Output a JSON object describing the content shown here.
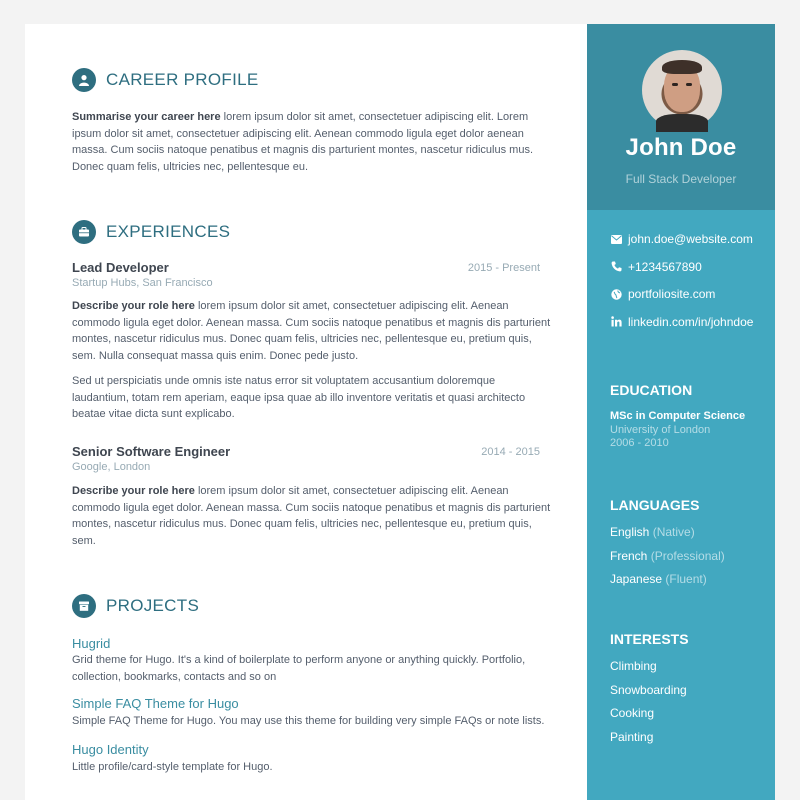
{
  "profile": {
    "name": "John Doe",
    "tagline": "Full Stack Developer"
  },
  "contact": [
    {
      "icon": "email-icon",
      "text": "john.doe@website.com"
    },
    {
      "icon": "phone-icon",
      "text": "+1234567890"
    },
    {
      "icon": "globe-icon",
      "text": "portfoliosite.com"
    },
    {
      "icon": "linkedin-icon",
      "text": "linkedin.com/in/johndoe"
    }
  ],
  "education": {
    "title": "EDUCATION",
    "degree": "MSc in Computer Science",
    "school": "University of London",
    "years": "2006 - 2010"
  },
  "languages": {
    "title": "LANGUAGES",
    "items": [
      {
        "name": "English",
        "level": "(Native)"
      },
      {
        "name": "French",
        "level": "(Professional)"
      },
      {
        "name": "Japanese",
        "level": "(Fluent)"
      }
    ]
  },
  "interests": {
    "title": "INTERESTS",
    "items": [
      "Climbing",
      "Snowboarding",
      "Cooking",
      "Painting"
    ]
  },
  "career": {
    "title": "CAREER PROFILE",
    "lead": "Summarise your career here",
    "text": " lorem ipsum dolor sit amet, consectetuer adipiscing elit. Lorem ipsum dolor sit amet, consectetuer adipiscing elit. Aenean commodo ligula eget dolor aenean massa. Cum sociis natoque penatibus et magnis dis parturient montes, nascetur ridiculus mus. Donec quam felis, ultricies nec, pellentesque eu."
  },
  "experiences": {
    "title": "EXPERIENCES",
    "jobs": [
      {
        "title": "Lead Developer",
        "company": "Startup Hubs, San Francisco",
        "time": "2015 - Present",
        "lead": "Describe your role here",
        "text": " lorem ipsum dolor sit amet, consectetuer adipiscing elit. Aenean commodo ligula eget dolor. Aenean massa. Cum sociis natoque penatibus et magnis dis parturient montes, nascetur ridiculus mus. Donec quam felis, ultricies nec, pellentesque eu, pretium quis, sem. Nulla consequat massa quis enim. Donec pede justo.",
        "text2": "Sed ut perspiciatis unde omnis iste natus error sit voluptatem accusantium doloremque laudantium, totam rem aperiam, eaque ipsa quae ab illo inventore veritatis et quasi architecto beatae vitae dicta sunt explicabo."
      },
      {
        "title": "Senior Software Engineer",
        "company": "Google, London",
        "time": "2014 - 2015",
        "lead": "Describe your role here",
        "text": " lorem ipsum dolor sit amet, consectetuer adipiscing elit. Aenean commodo ligula eget dolor. Aenean massa. Cum sociis natoque penatibus et magnis dis parturient montes, nascetur ridiculus mus. Donec quam felis, ultricies nec, pellentesque eu, pretium quis, sem."
      }
    ]
  },
  "projects": {
    "title": "PROJECTS",
    "items": [
      {
        "title": "Hugrid",
        "desc": "Grid theme for Hugo. It's a kind of boilerplate to perform anyone or anything quickly. Portfolio, collection, bookmarks, contacts and so on"
      },
      {
        "title": "Simple FAQ Theme for Hugo",
        "desc": "Simple FAQ Theme for Hugo. You may use this theme for building very simple FAQs or note lists."
      },
      {
        "title": "Hugo Identity",
        "desc": "Little profile/card-style template for Hugo."
      }
    ]
  },
  "colors": {
    "accent": "#2e6e80",
    "sidebar": "#42a8c0",
    "sidebar_header": "#3a8da1"
  }
}
